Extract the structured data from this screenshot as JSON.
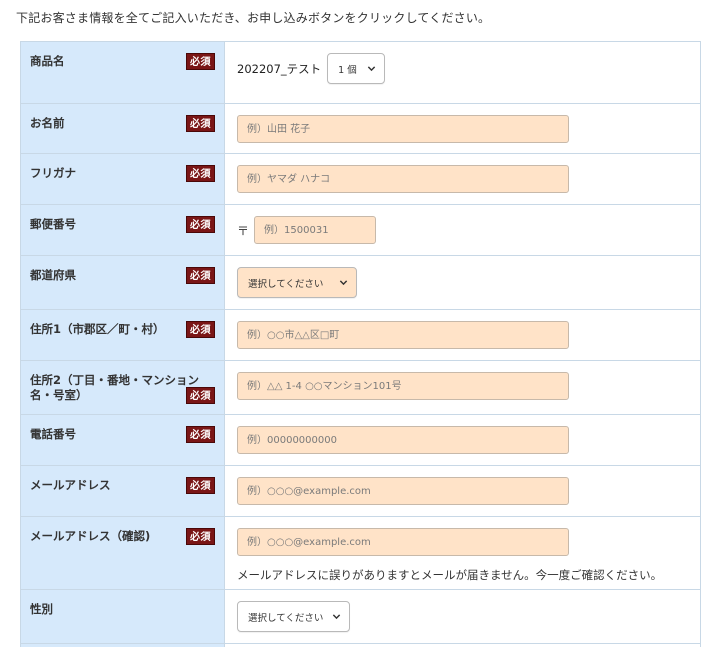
{
  "intro_text": "下記お客さま情報を全てご記入いただき、お申し込みボタンをクリックしてください。",
  "required_badge": "必須",
  "product": {
    "label": "商品名",
    "name": "202207_テスト",
    "quantity_selected": "1 個"
  },
  "name": {
    "label": "お名前",
    "placeholder": "例）山田 花子"
  },
  "furigana": {
    "label": "フリガナ",
    "placeholder": "例）ヤマダ ハナコ"
  },
  "postal": {
    "label": "郵便番号",
    "mark": "〒",
    "placeholder": "例）1500031"
  },
  "prefecture": {
    "label": "都道府県",
    "selected": "選択してください"
  },
  "address1": {
    "label": "住所1（市郡区／町・村）",
    "placeholder": "例）○○市△△区□町"
  },
  "address2": {
    "label": "住所2（丁目・番地・マンション名・号室）",
    "placeholder": "例）△△ 1-4 ○○マンション101号"
  },
  "phone": {
    "label": "電話番号",
    "placeholder": "例）00000000000"
  },
  "email": {
    "label": "メールアドレス",
    "placeholder": "例）○○○@example.com"
  },
  "email_confirm": {
    "label": "メールアドレス（確認)",
    "placeholder": "例）○○○@example.com",
    "note": "メールアドレスに誤りがありますとメールが届きません。今一度ご確認ください。"
  },
  "gender": {
    "label": "性別",
    "selected": "選択してください"
  },
  "colors": {
    "label_bg": "#d6e9fb",
    "input_bg": "#ffe3c8",
    "required_bg": "#7a1616",
    "border": "#c8d8e6"
  }
}
